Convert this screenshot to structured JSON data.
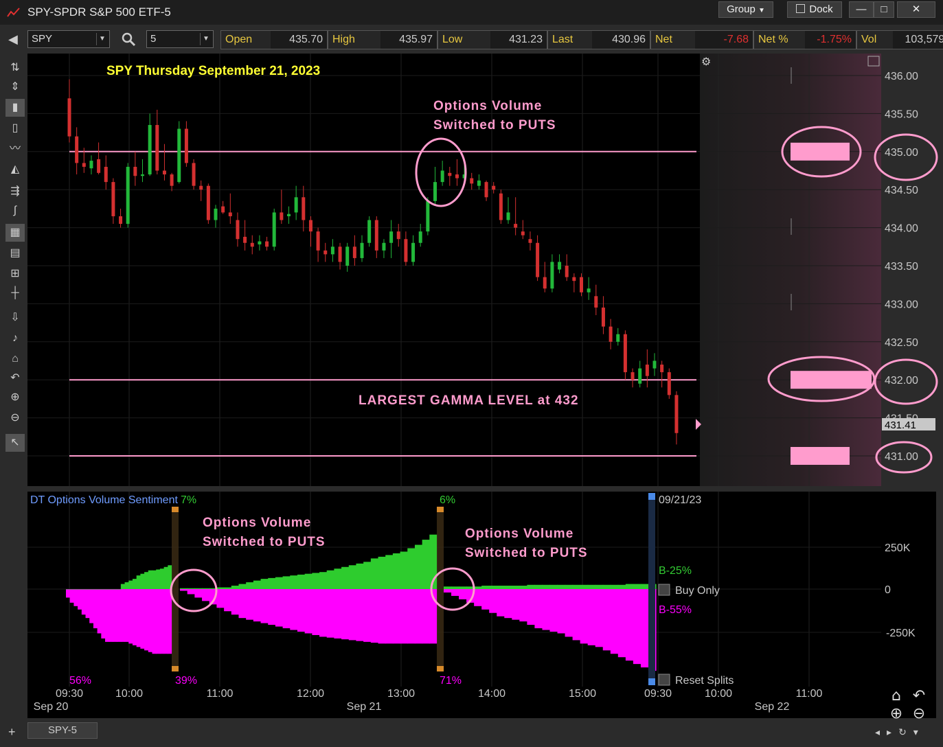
{
  "window": {
    "title": "SPY-SPDR S&P 500 ETF-5",
    "group_label": "Group",
    "dock_label": "Dock",
    "min_glyph": "—",
    "max_glyph": "□",
    "close_glyph": "✕"
  },
  "toolbar": {
    "symbol": "SPY",
    "interval": "5",
    "quote": [
      {
        "label": "Open",
        "value": "435.70",
        "neg": false
      },
      {
        "label": "High",
        "value": "435.97",
        "neg": false
      },
      {
        "label": "Low",
        "value": "431.23",
        "neg": false
      },
      {
        "label": "Last",
        "value": "430.96",
        "neg": false
      },
      {
        "label": "Net",
        "value": "-7.68",
        "neg": true
      },
      {
        "label": "Net %",
        "value": "-1.75%",
        "neg": true
      },
      {
        "label": "Vol",
        "value": "103,579K",
        "neg": false
      }
    ]
  },
  "colors": {
    "up": "#22b83a",
    "down": "#d43030",
    "pink": "#ff9ccd",
    "magenta": "#ff00ff",
    "green_area": "#2ecc2e",
    "yellow": "#ffff33",
    "axis_text": "#c8c8c8"
  },
  "chart_data": [
    {
      "type": "candlestick",
      "title": "SPY Thursday September 21, 2023",
      "ylim": [
        430.6,
        436.2
      ],
      "y_ticks": [
        "436.00",
        "435.50",
        "435.00",
        "434.50",
        "434.00",
        "433.50",
        "433.00",
        "432.50",
        "432.00",
        "431.50",
        "431.00"
      ],
      "last_price_label": "431.41",
      "horizontal_lines": [
        435.0,
        432.0,
        431.0
      ],
      "annotations": [
        "Options Volume",
        "Switched to PUTS",
        "LARGEST GAMMA LEVEL at 432"
      ],
      "candles": [
        {
          "x": 0,
          "o": 435.7,
          "h": 435.95,
          "l": 435.12,
          "c": 435.2
        },
        {
          "x": 1,
          "o": 435.2,
          "h": 435.32,
          "l": 434.7,
          "c": 434.85
        },
        {
          "x": 2,
          "o": 434.85,
          "h": 435.05,
          "l": 434.72,
          "c": 434.8
        },
        {
          "x": 3,
          "o": 434.78,
          "h": 434.95,
          "l": 434.7,
          "c": 434.88
        },
        {
          "x": 4,
          "o": 434.9,
          "h": 435.12,
          "l": 434.7,
          "c": 434.72
        },
        {
          "x": 5,
          "o": 434.8,
          "h": 434.95,
          "l": 434.5,
          "c": 434.6
        },
        {
          "x": 6,
          "o": 434.6,
          "h": 434.65,
          "l": 434.05,
          "c": 434.15
        },
        {
          "x": 7,
          "o": 434.15,
          "h": 434.25,
          "l": 434.0,
          "c": 434.05
        },
        {
          "x": 8,
          "o": 434.05,
          "h": 434.85,
          "l": 434.0,
          "c": 434.8
        },
        {
          "x": 9,
          "o": 434.8,
          "h": 435.0,
          "l": 434.55,
          "c": 434.68
        },
        {
          "x": 10,
          "o": 434.68,
          "h": 434.9,
          "l": 434.6,
          "c": 434.7
        },
        {
          "x": 11,
          "o": 434.7,
          "h": 435.5,
          "l": 434.68,
          "c": 435.35
        },
        {
          "x": 12,
          "o": 435.35,
          "h": 435.55,
          "l": 434.7,
          "c": 434.75
        },
        {
          "x": 13,
          "o": 434.75,
          "h": 435.1,
          "l": 434.62,
          "c": 434.7
        },
        {
          "x": 14,
          "o": 434.7,
          "h": 434.72,
          "l": 434.48,
          "c": 434.55
        },
        {
          "x": 15,
          "o": 434.6,
          "h": 435.4,
          "l": 434.58,
          "c": 435.3
        },
        {
          "x": 16,
          "o": 435.3,
          "h": 435.4,
          "l": 434.8,
          "c": 434.85
        },
        {
          "x": 17,
          "o": 434.85,
          "h": 434.9,
          "l": 434.5,
          "c": 434.55
        },
        {
          "x": 18,
          "o": 434.55,
          "h": 434.62,
          "l": 434.35,
          "c": 434.5
        },
        {
          "x": 19,
          "o": 434.55,
          "h": 434.58,
          "l": 434.05,
          "c": 434.1
        },
        {
          "x": 20,
          "o": 434.1,
          "h": 434.3,
          "l": 434.0,
          "c": 434.25
        },
        {
          "x": 21,
          "o": 434.28,
          "h": 434.35,
          "l": 434.18,
          "c": 434.2
        },
        {
          "x": 22,
          "o": 434.2,
          "h": 434.45,
          "l": 434.05,
          "c": 434.15
        },
        {
          "x": 23,
          "o": 434.1,
          "h": 434.2,
          "l": 433.75,
          "c": 433.85
        },
        {
          "x": 24,
          "o": 433.88,
          "h": 434.1,
          "l": 433.7,
          "c": 433.8
        },
        {
          "x": 25,
          "o": 433.8,
          "h": 433.9,
          "l": 433.65,
          "c": 433.75
        },
        {
          "x": 26,
          "o": 433.78,
          "h": 433.9,
          "l": 433.7,
          "c": 433.82
        },
        {
          "x": 27,
          "o": 433.82,
          "h": 433.88,
          "l": 433.7,
          "c": 433.75
        },
        {
          "x": 28,
          "o": 433.75,
          "h": 434.25,
          "l": 433.7,
          "c": 434.2
        },
        {
          "x": 29,
          "o": 434.2,
          "h": 434.5,
          "l": 434.05,
          "c": 434.1
        },
        {
          "x": 30,
          "o": 434.15,
          "h": 434.28,
          "l": 434.05,
          "c": 434.18
        },
        {
          "x": 31,
          "o": 434.2,
          "h": 434.55,
          "l": 434.1,
          "c": 434.4
        },
        {
          "x": 32,
          "o": 434.4,
          "h": 434.55,
          "l": 433.95,
          "c": 434.1
        },
        {
          "x": 33,
          "o": 434.1,
          "h": 434.15,
          "l": 433.75,
          "c": 433.95
        },
        {
          "x": 34,
          "o": 433.95,
          "h": 434.0,
          "l": 433.55,
          "c": 433.7
        },
        {
          "x": 35,
          "o": 433.7,
          "h": 433.8,
          "l": 433.55,
          "c": 433.65
        },
        {
          "x": 36,
          "o": 433.65,
          "h": 433.85,
          "l": 433.55,
          "c": 433.75
        },
        {
          "x": 37,
          "o": 433.75,
          "h": 433.8,
          "l": 433.45,
          "c": 433.55
        },
        {
          "x": 38,
          "o": 433.5,
          "h": 433.8,
          "l": 433.42,
          "c": 433.75
        },
        {
          "x": 39,
          "o": 433.75,
          "h": 433.9,
          "l": 433.5,
          "c": 433.6
        },
        {
          "x": 40,
          "o": 433.6,
          "h": 433.9,
          "l": 433.55,
          "c": 433.8
        },
        {
          "x": 41,
          "o": 433.8,
          "h": 434.15,
          "l": 433.75,
          "c": 434.1
        },
        {
          "x": 42,
          "o": 434.1,
          "h": 434.15,
          "l": 433.6,
          "c": 433.7
        },
        {
          "x": 43,
          "o": 433.7,
          "h": 433.85,
          "l": 433.6,
          "c": 433.8
        },
        {
          "x": 44,
          "o": 433.8,
          "h": 434.1,
          "l": 433.6,
          "c": 433.95
        },
        {
          "x": 45,
          "o": 433.95,
          "h": 434.05,
          "l": 433.75,
          "c": 433.85
        },
        {
          "x": 46,
          "o": 433.85,
          "h": 433.95,
          "l": 433.5,
          "c": 433.55
        },
        {
          "x": 47,
          "o": 433.55,
          "h": 433.9,
          "l": 433.5,
          "c": 433.8
        },
        {
          "x": 48,
          "o": 433.8,
          "h": 434.05,
          "l": 433.75,
          "c": 433.95
        },
        {
          "x": 49,
          "o": 433.95,
          "h": 434.4,
          "l": 433.9,
          "c": 434.35
        },
        {
          "x": 50,
          "o": 434.35,
          "h": 434.8,
          "l": 434.3,
          "c": 434.6
        },
        {
          "x": 51,
          "o": 434.6,
          "h": 434.88,
          "l": 434.55,
          "c": 434.75
        },
        {
          "x": 52,
          "o": 434.72,
          "h": 434.8,
          "l": 434.55,
          "c": 434.68
        },
        {
          "x": 53,
          "o": 434.7,
          "h": 434.9,
          "l": 434.55,
          "c": 434.65
        },
        {
          "x": 54,
          "o": 434.65,
          "h": 434.9,
          "l": 434.6,
          "c": 434.7
        },
        {
          "x": 55,
          "o": 434.65,
          "h": 434.72,
          "l": 434.5,
          "c": 434.58
        },
        {
          "x": 56,
          "o": 434.55,
          "h": 434.7,
          "l": 434.5,
          "c": 434.62
        },
        {
          "x": 57,
          "o": 434.6,
          "h": 434.62,
          "l": 434.35,
          "c": 434.4
        },
        {
          "x": 58,
          "o": 434.55,
          "h": 434.6,
          "l": 434.45,
          "c": 434.5
        },
        {
          "x": 59,
          "o": 434.45,
          "h": 434.5,
          "l": 434.05,
          "c": 434.1
        },
        {
          "x": 60,
          "o": 434.1,
          "h": 434.4,
          "l": 434.05,
          "c": 434.2
        },
        {
          "x": 61,
          "o": 434.05,
          "h": 434.4,
          "l": 433.9,
          "c": 434.0
        },
        {
          "x": 62,
          "o": 433.95,
          "h": 434.1,
          "l": 433.85,
          "c": 433.9
        },
        {
          "x": 63,
          "o": 433.85,
          "h": 433.95,
          "l": 433.7,
          "c": 433.8
        },
        {
          "x": 64,
          "o": 433.8,
          "h": 433.9,
          "l": 433.3,
          "c": 433.35
        },
        {
          "x": 65,
          "o": 433.35,
          "h": 433.55,
          "l": 433.15,
          "c": 433.2
        },
        {
          "x": 66,
          "o": 433.2,
          "h": 433.65,
          "l": 433.15,
          "c": 433.55
        },
        {
          "x": 67,
          "o": 433.45,
          "h": 433.65,
          "l": 433.4,
          "c": 433.55
        },
        {
          "x": 68,
          "o": 433.5,
          "h": 433.65,
          "l": 433.3,
          "c": 433.35
        },
        {
          "x": 69,
          "o": 433.35,
          "h": 433.4,
          "l": 433.15,
          "c": 433.3
        },
        {
          "x": 70,
          "o": 433.35,
          "h": 433.4,
          "l": 433.1,
          "c": 433.15
        },
        {
          "x": 71,
          "o": 433.15,
          "h": 433.35,
          "l": 433.05,
          "c": 433.2
        },
        {
          "x": 72,
          "o": 433.1,
          "h": 433.25,
          "l": 432.85,
          "c": 432.95
        },
        {
          "x": 73,
          "o": 432.95,
          "h": 433.1,
          "l": 432.6,
          "c": 432.7
        },
        {
          "x": 74,
          "o": 432.7,
          "h": 432.8,
          "l": 432.4,
          "c": 432.5
        },
        {
          "x": 75,
          "o": 432.5,
          "h": 432.68,
          "l": 432.45,
          "c": 432.6
        },
        {
          "x": 76,
          "o": 432.6,
          "h": 432.65,
          "l": 432.0,
          "c": 432.1
        },
        {
          "x": 77,
          "o": 432.1,
          "h": 432.15,
          "l": 431.9,
          "c": 432.0
        },
        {
          "x": 78,
          "o": 431.95,
          "h": 432.25,
          "l": 431.9,
          "c": 432.15
        },
        {
          "x": 79,
          "o": 432.2,
          "h": 432.4,
          "l": 431.9,
          "c": 432.05
        },
        {
          "x": 80,
          "o": 432.15,
          "h": 432.35,
          "l": 432.05,
          "c": 432.25
        },
        {
          "x": 81,
          "o": 432.2,
          "h": 432.25,
          "l": 431.9,
          "c": 432.1
        },
        {
          "x": 82,
          "o": 432.1,
          "h": 432.15,
          "l": 431.75,
          "c": 431.8
        },
        {
          "x": 83,
          "o": 431.8,
          "h": 431.85,
          "l": 431.15,
          "c": 431.3
        }
      ],
      "volume_profile_levels": [
        435.0,
        432.0,
        431.0
      ],
      "volume_profile_fraction": [
        0.7,
        1.0,
        0.7
      ],
      "x_labels": [
        "09:30",
        "10:00",
        "11:00",
        "12:00",
        "13:00",
        "14:00",
        "15:00",
        "09:30",
        "10:00",
        "11:00"
      ],
      "date_labels": [
        "Sep 20",
        "Sep 21",
        "Sep 22"
      ]
    },
    {
      "type": "area",
      "title": "DT Options Volume Sentiment",
      "y_ticks": [
        "250K",
        "0",
        "-250K"
      ],
      "ylim": [
        -500000,
        450000
      ],
      "percent_labels": [
        "7%",
        "6%",
        "56%",
        "39%",
        "71%"
      ],
      "right_labels": {
        "date": "09/21/23",
        "buy_pct": "B-25%",
        "buy_only": "Buy Only",
        "sell_pct": "B-55%",
        "reset": "Reset Splits"
      },
      "annotations": [
        "Options Volume",
        "Switched to PUTS"
      ],
      "calls_segment1": [
        0,
        0,
        0,
        0,
        0,
        0,
        0,
        0,
        0,
        0,
        0,
        0,
        0,
        0,
        30000,
        40000,
        50000,
        60000,
        80000,
        90000,
        100000,
        110000,
        110000,
        115000,
        120000,
        130000,
        140000
      ],
      "puts_segment1": [
        -50000,
        -80000,
        -100000,
        -120000,
        -150000,
        -170000,
        -200000,
        -230000,
        -260000,
        -290000,
        -310000,
        -310000,
        -310000,
        -310000,
        -310000,
        -310000,
        -320000,
        -330000,
        -340000,
        -350000,
        -360000,
        -370000,
        -380000,
        -380000,
        -380000,
        -380000,
        -380000
      ],
      "calls_segment2": [
        5000,
        5000,
        5000,
        5000,
        5000,
        10000,
        10000,
        20000,
        30000,
        40000,
        50000,
        60000,
        65000,
        70000,
        75000,
        80000,
        85000,
        90000,
        95000,
        100000,
        110000,
        120000,
        130000,
        140000,
        150000,
        160000,
        180000,
        190000,
        200000,
        210000,
        220000,
        240000,
        260000,
        290000,
        320000
      ],
      "puts_segment2": [
        -10000,
        -30000,
        -50000,
        -70000,
        -90000,
        -110000,
        -130000,
        -150000,
        -170000,
        -180000,
        -190000,
        -200000,
        -210000,
        -220000,
        -230000,
        -240000,
        -250000,
        -260000,
        -270000,
        -280000,
        -285000,
        -290000,
        -295000,
        -300000,
        -305000,
        -310000,
        -315000,
        -320000,
        -320000,
        -320000,
        -320000,
        -320000,
        -320000,
        -320000,
        -320000
      ],
      "calls_segment3": [
        15000,
        15000,
        15000,
        15000,
        15000,
        20000,
        20000,
        20000,
        20000,
        20000,
        20000,
        25000,
        25000,
        25000,
        25000,
        25000,
        25000,
        25000,
        25000,
        25000,
        25000,
        25000,
        25000,
        25000,
        30000,
        30000,
        30000,
        30000
      ],
      "puts_segment3": [
        -20000,
        -40000,
        -60000,
        -80000,
        -100000,
        -120000,
        -140000,
        -160000,
        -170000,
        -180000,
        -190000,
        -210000,
        -230000,
        -240000,
        -250000,
        -260000,
        -280000,
        -300000,
        -320000,
        -330000,
        -340000,
        -360000,
        -380000,
        -400000,
        -420000,
        -440000,
        -460000,
        -480000
      ]
    }
  ],
  "sidebar_tools": [
    "cursor-tool",
    "line-tool",
    "candle-tool",
    "bar-tool",
    "line-chart-tool",
    "area-tool",
    "fib-tool",
    "curve-tool",
    "grid-tool",
    "table-tool",
    "split-tool",
    "crosshair-tool",
    "scroll-tool",
    "zoom-h-tool",
    "home-tool",
    "undo-tool",
    "zoom-in-tool",
    "zoom-out-tool",
    "select-tool"
  ],
  "statusbar": {
    "tab_label": "SPY-5",
    "plus": "+"
  }
}
